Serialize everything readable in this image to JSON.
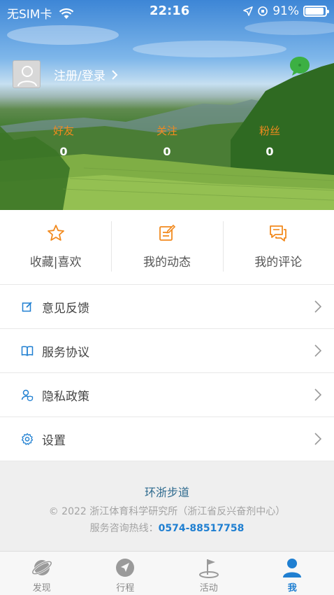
{
  "status_bar": {
    "carrier": "无SIM卡",
    "time": "22:16",
    "battery": "91%"
  },
  "profile": {
    "login_label": "注册/登录"
  },
  "stats": [
    {
      "label": "好友",
      "value": "0"
    },
    {
      "label": "关注",
      "value": "0"
    },
    {
      "label": "粉丝",
      "value": "0"
    }
  ],
  "quick_actions": [
    {
      "label": "收藏|喜欢",
      "icon": "star-icon"
    },
    {
      "label": "我的动态",
      "icon": "edit-note-icon"
    },
    {
      "label": "我的评论",
      "icon": "comment-icon"
    }
  ],
  "menu": [
    {
      "label": "意见反馈",
      "icon": "feedback-icon"
    },
    {
      "label": "服务协议",
      "icon": "book-icon"
    },
    {
      "label": "隐私政策",
      "icon": "user-shield-icon"
    },
    {
      "label": "设置",
      "icon": "gear-icon"
    }
  ],
  "footer": {
    "name": "环浙步道",
    "copyright": "© 2022 浙江体育科学研究所（浙江省反兴奋剂中心）",
    "hotline_label": "服务咨询热线：",
    "hotline_number": "0574-88517758"
  },
  "tabs": [
    {
      "label": "发现",
      "icon": "planet-icon",
      "active": false
    },
    {
      "label": "行程",
      "icon": "navigate-icon",
      "active": false
    },
    {
      "label": "活动",
      "icon": "flag-icon",
      "active": false
    },
    {
      "label": "我",
      "icon": "person-icon",
      "active": true
    }
  ],
  "colors": {
    "accent_orange": "#f28a1e",
    "accent_blue": "#1f7fd1",
    "chat_green": "#3cb043"
  }
}
